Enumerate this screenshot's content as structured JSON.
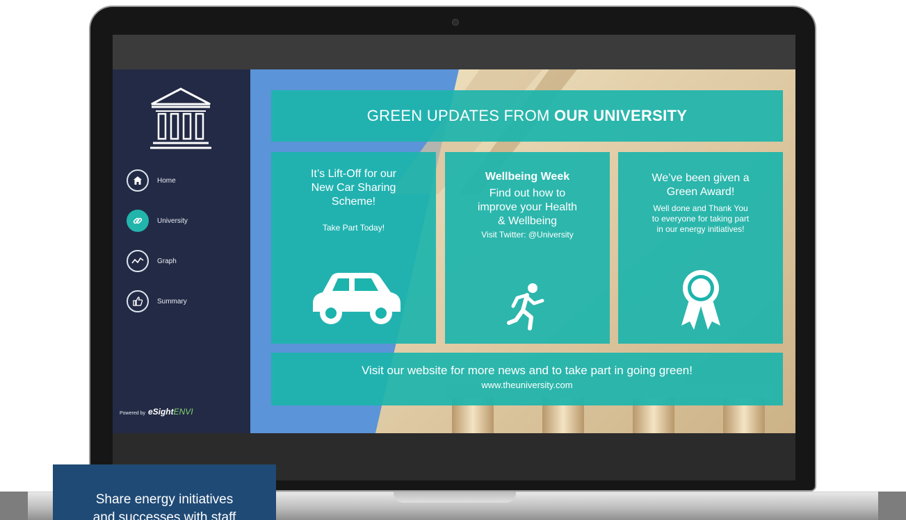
{
  "main": {
    "title_plain": "GREEN UPDATES FROM ",
    "title_bold": "OUR UNIVERSITY",
    "cards": [
      {
        "lines": [
          "It’s Lift-Off for our",
          "New Car Sharing",
          "Scheme!"
        ],
        "sub": "Take Part Today!",
        "icon": "car-icon"
      },
      {
        "bold": "Wellbeing Week",
        "lines": [
          "Find out how to",
          "improve your Health",
          "& Wellbeing"
        ],
        "sub": "Visit Twitter: @University",
        "icon": "runner-icon"
      },
      {
        "lines": [
          "We’ve been given a",
          "Green Award!"
        ],
        "sub_lines": [
          "Well done and Thank You",
          "to everyone for taking part",
          "in our energy initiatives!"
        ],
        "icon": "award-ribbon-icon"
      }
    ],
    "footer": {
      "headline": "Visit our website for more news and to take part in going green!",
      "url": "www.theuniversity.com"
    }
  },
  "sidebar": {
    "logo_icon": "university-building-icon",
    "items": [
      {
        "label": "Home",
        "icon": "home-icon",
        "active": false
      },
      {
        "label": "University",
        "icon": "link-icon",
        "active": true
      },
      {
        "label": "Graph",
        "icon": "line-graph-icon",
        "active": false
      },
      {
        "label": "Summary",
        "icon": "thumbs-up-icon",
        "active": false
      }
    ],
    "powered_by": {
      "prefix": "Powered by",
      "brand": "eSight",
      "brand_suffix": "ENVI"
    }
  },
  "caption": {
    "line1": "Share energy initiatives",
    "line2": "and successes with staff"
  },
  "colors": {
    "sidebar_bg": "#232a45",
    "teal_panel": "#1cb4ac",
    "main_bg": "#5b94d8",
    "caption_bg": "#1f4a75",
    "active_nav": "#22b5ac"
  }
}
